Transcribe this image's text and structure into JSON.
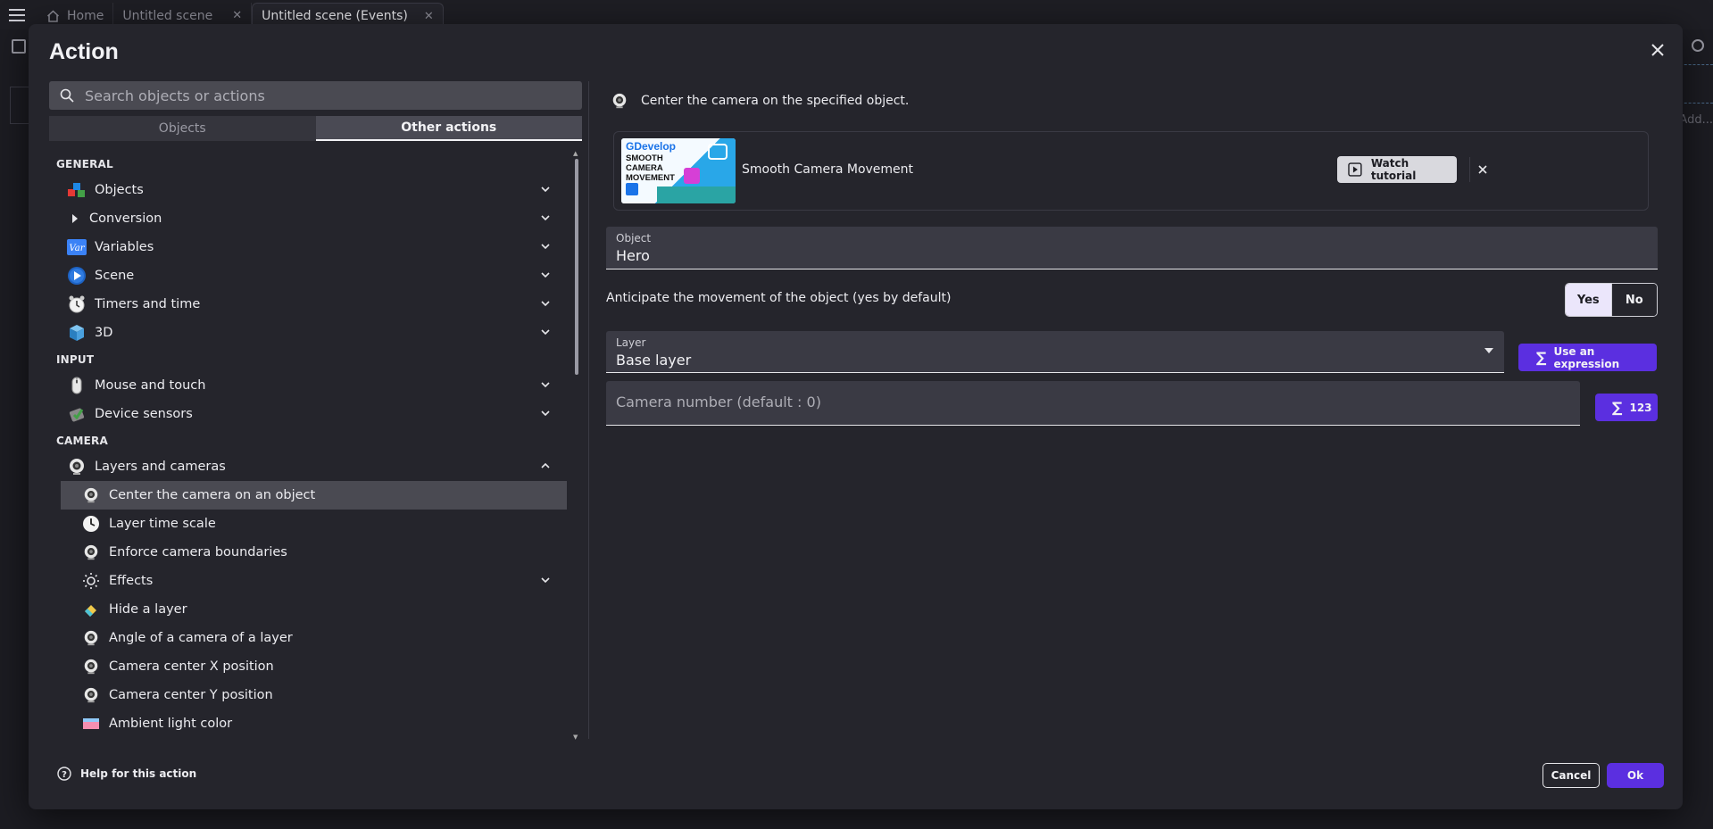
{
  "topbar": {
    "tabs": [
      {
        "label": "Home"
      },
      {
        "label": "Untitled scene"
      },
      {
        "label": "Untitled scene (Events)"
      }
    ],
    "bg_add_text": "Add..."
  },
  "dialog": {
    "title": "Action",
    "search": {
      "placeholder": "Search objects or actions",
      "value": ""
    },
    "tabs": [
      {
        "label": "Objects",
        "selected": false
      },
      {
        "label": "Other actions",
        "selected": true
      }
    ],
    "sections": {
      "general": "GENERAL",
      "input": "INPUT",
      "camera": "CAMERA"
    },
    "items": {
      "objects": "Objects",
      "conversion": "Conversion",
      "variables": "Variables",
      "scene": "Scene",
      "timers": "Timers and time",
      "three_d": "3D",
      "mouse": "Mouse and touch",
      "sensors": "Device sensors",
      "layers": "Layers and cameras",
      "center_camera": "Center the camera on an object",
      "layer_time_scale": "Layer time scale",
      "enforce_bounds": "Enforce camera boundaries",
      "effects": "Effects",
      "hide_layer": "Hide a layer",
      "camera_angle": "Angle of a camera of a layer",
      "camera_x": "Camera center X position",
      "camera_y": "Camera center Y position",
      "ambient": "Ambient light color"
    },
    "description": "Center the camera on the specified object.",
    "tutorial": {
      "thumb_brand": "GDevelop",
      "thumb_title": [
        "SMOOTH",
        "CAMERA",
        "MOVEMENT"
      ],
      "name": "Smooth Camera Movement",
      "watch_label": "Watch tutorial"
    },
    "object_field": {
      "label": "Object",
      "value": "Hero"
    },
    "anticipate": {
      "label": "Anticipate the movement of the object (yes by default)",
      "yes": "Yes",
      "no": "No",
      "selected": "Yes"
    },
    "layer_field": {
      "label": "Layer",
      "value": "Base layer"
    },
    "use_expression": "Use an expression",
    "camera_field": {
      "placeholder": "Camera number (default : 0)",
      "value": ""
    },
    "num_button": "123",
    "help": "Help for this action",
    "cancel": "Cancel",
    "ok": "Ok"
  },
  "colors": {
    "accent": "#5b2fe0",
    "bg": "#25252c",
    "field": "#3a3a44"
  }
}
